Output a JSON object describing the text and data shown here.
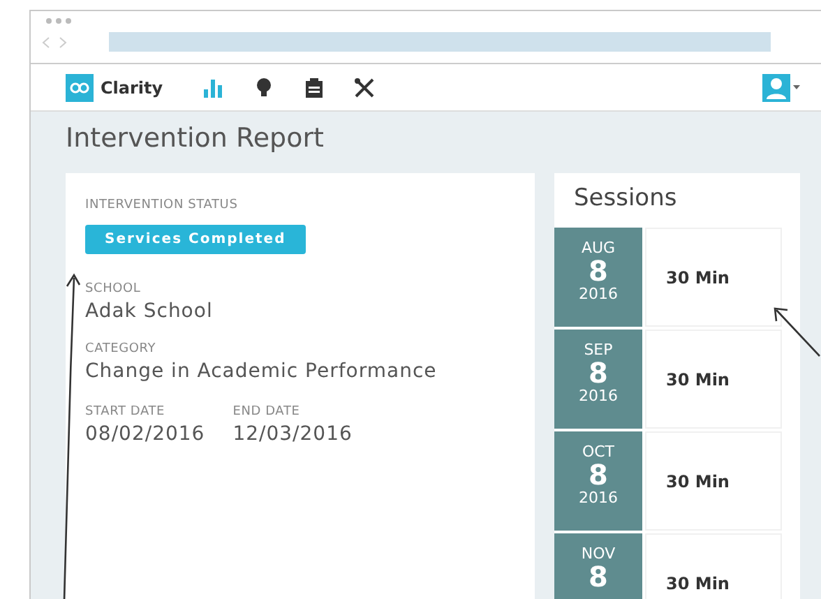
{
  "app": {
    "name": "Clarity"
  },
  "nav": [
    {
      "kind": "chart",
      "selected": true
    },
    {
      "kind": "bulb",
      "selected": false
    },
    {
      "kind": "clipboard",
      "selected": false
    },
    {
      "kind": "tools",
      "selected": false
    }
  ],
  "page_title": "Intervention Report",
  "status": {
    "label": "INTERVENTION STATUS",
    "value": "Services Completed"
  },
  "fields": [
    {
      "label": "SCHOOL",
      "value": "Adak School"
    },
    {
      "label": "CATEGORY",
      "value": "Change in Academic Performance"
    }
  ],
  "dates": [
    {
      "label": "START DATE",
      "value": "08/02/2016"
    },
    {
      "label": "END DATE",
      "value": "12/03/2016"
    }
  ],
  "sessions": {
    "title": "Sessions",
    "items": [
      {
        "month": "AUG",
        "day": "8",
        "year": "2016",
        "duration": "30 Min"
      },
      {
        "month": "SEP",
        "day": "8",
        "year": "2016",
        "duration": "30 Min"
      },
      {
        "month": "OCT",
        "day": "8",
        "year": "2016",
        "duration": "30 Min"
      },
      {
        "month": "NOV",
        "day": "8",
        "duration": "30 Min"
      }
    ]
  }
}
